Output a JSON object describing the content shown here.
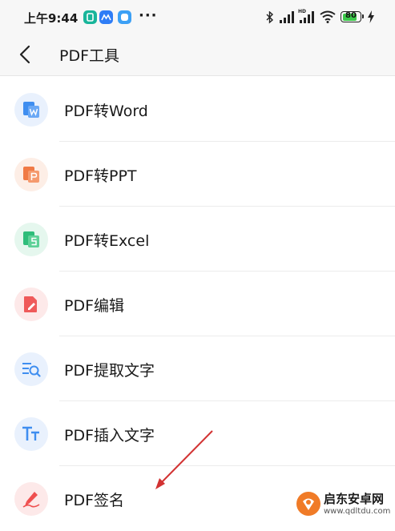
{
  "status_bar": {
    "time": "上午9:44",
    "more": "···",
    "battery": "80",
    "icons": [
      "app-notification-icon",
      "app-notification-icon",
      "app-notification-icon",
      "bluetooth-icon",
      "signal-icon",
      "hd-signal-icon",
      "wifi-icon",
      "battery-icon",
      "charging-icon"
    ]
  },
  "header": {
    "title": "PDF工具",
    "back_icon": "chevron-left-icon"
  },
  "tools": [
    {
      "label": "PDF转Word",
      "icon": "word-doc-icon",
      "color": "#3f8ef0",
      "bg": "#e9f1fd"
    },
    {
      "label": "PDF转PPT",
      "icon": "ppt-doc-icon",
      "color": "#f07a45",
      "bg": "#fdeee6"
    },
    {
      "label": "PDF转Excel",
      "icon": "excel-doc-icon",
      "color": "#2ebd7a",
      "bg": "#e5f7ee"
    },
    {
      "label": "PDF编辑",
      "icon": "edit-doc-icon",
      "color": "#ef5a5a",
      "bg": "#fde9e9"
    },
    {
      "label": "PDF提取文字",
      "icon": "extract-text-icon",
      "color": "#3f8ef0",
      "bg": "#e9f1fd"
    },
    {
      "label": "PDF插入文字",
      "icon": "insert-text-icon",
      "color": "#3f8ef0",
      "bg": "#e9f1fd"
    },
    {
      "label": "PDF签名",
      "icon": "signature-pen-icon",
      "color": "#ef4f4f",
      "bg": "#fde9e9"
    }
  ],
  "watermark": {
    "text": "启东安卓网",
    "url": "www.qdltdu.com"
  },
  "annotation": {
    "color": "#d23232"
  }
}
